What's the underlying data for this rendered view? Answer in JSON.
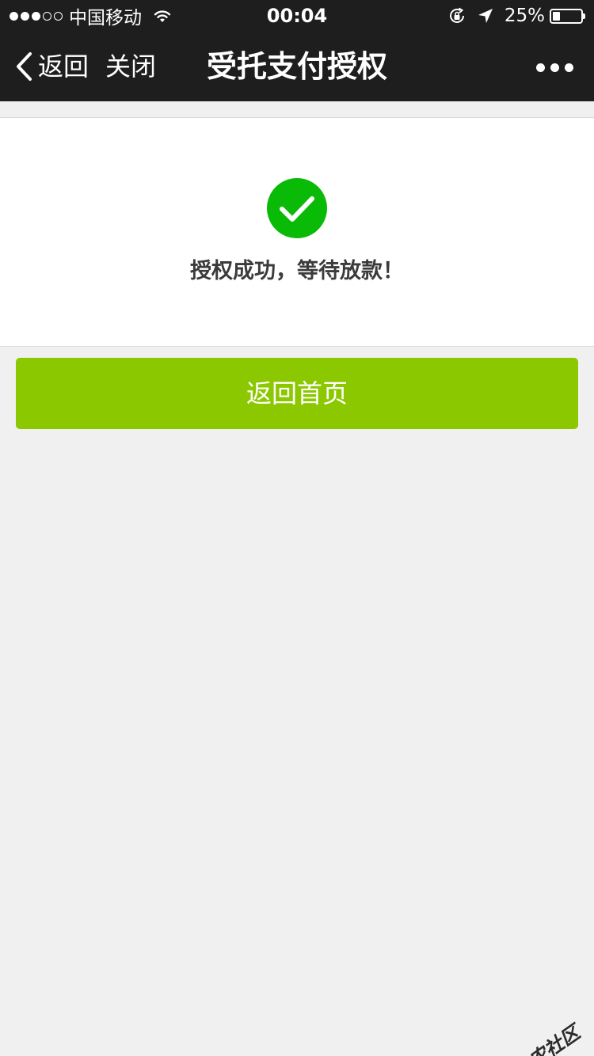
{
  "status_bar": {
    "signal": {
      "filled": 3,
      "total": 5
    },
    "carrier": "中国移动",
    "time": "00:04",
    "battery_percent_label": "25%",
    "battery_level": 0.25,
    "icons": [
      "wifi-icon",
      "rotation-lock-icon",
      "location-arrow-icon",
      "battery-icon"
    ]
  },
  "nav": {
    "back_label": "返回",
    "close_label": "关闭",
    "title": "受托支付授权",
    "more_icon": "more-dots-icon"
  },
  "result": {
    "icon": "success-check-icon",
    "message": "授权成功，等待放款！"
  },
  "actions": {
    "home_button_label": "返回首页"
  },
  "watermark": {
    "text": "卡农社区"
  },
  "colors": {
    "status_bar_bg": "#1e1e1f",
    "page_bg": "#f0f0f0",
    "success_green": "#09bb07",
    "button_green": "#8cc800"
  }
}
